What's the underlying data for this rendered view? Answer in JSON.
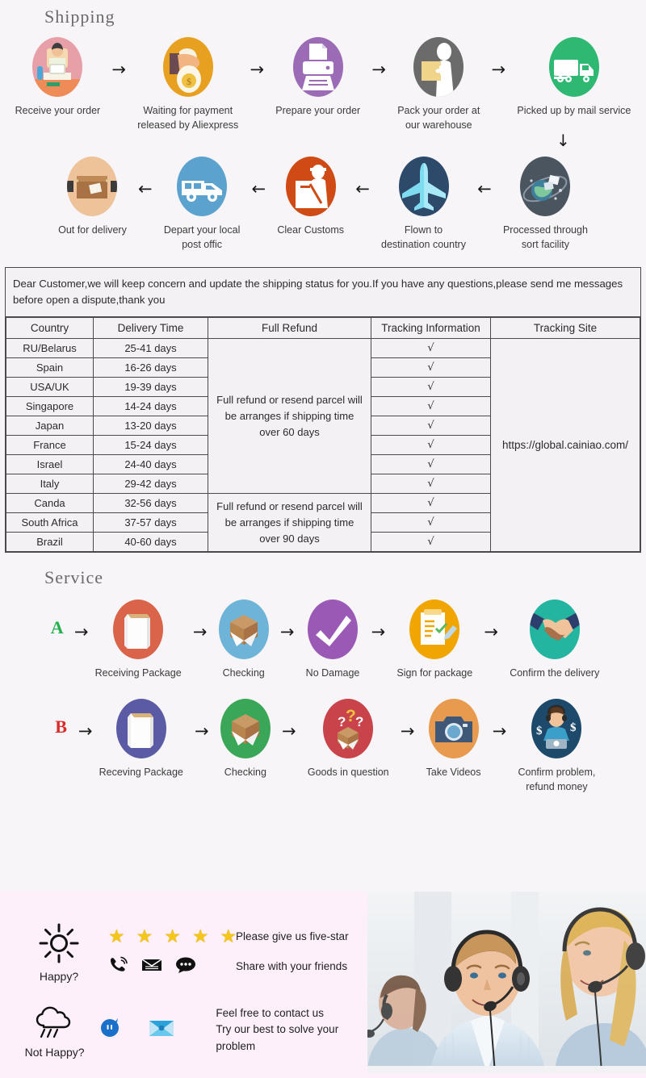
{
  "sections": {
    "shipping_title": "Shipping",
    "service_title": "Service"
  },
  "shipping_flow_row1": [
    {
      "label": "Receive your order",
      "icon": "person-at-desk-icon",
      "color": "#e8a0a8"
    },
    {
      "label": "Waiting for payment\nreleased by Aliexpress",
      "icon": "hand-with-coin-icon",
      "color": "#e8a020"
    },
    {
      "label": "Prepare your order",
      "icon": "printer-icon",
      "color": "#9b6bb5"
    },
    {
      "label": "Pack your order at\nour warehouse",
      "icon": "worker-with-box-icon",
      "color": "#6b6b6b"
    },
    {
      "label": "Picked up by mail service",
      "icon": "delivery-truck-icon",
      "color": "#2eb872"
    }
  ],
  "shipping_flow_row2": [
    {
      "label": "Out for delivery",
      "icon": "parcel-box-icon",
      "color": "#eec39a"
    },
    {
      "label": "Depart your local\npost offic",
      "icon": "delivery-van-icon",
      "color": "#5ba3ce"
    },
    {
      "label": "Clear  Customs",
      "icon": "customs-officer-icon",
      "color": "#cf4a15"
    },
    {
      "label": "Flown to\ndestination country",
      "icon": "airplane-icon",
      "color": "#2d4a6b"
    },
    {
      "label": "Processed through\nsort facility",
      "icon": "globe-sorting-icon",
      "color": "#4a5560"
    }
  ],
  "arrow_right": "→",
  "arrow_left": "←",
  "arrow_down": "↓",
  "notice": "Dear Customer,we will keep concern and update the shipping status for you.If you have any questions,please send me messages before open a dispute,thank you",
  "table": {
    "headers": [
      "Country",
      "Delivery Time",
      "Full Refund",
      "Tracking Information",
      "Tracking Site"
    ],
    "rows": [
      {
        "country": "RU/Belarus",
        "delivery": "25-41 days",
        "tracking": "√"
      },
      {
        "country": "Spain",
        "delivery": "16-26 days",
        "tracking": "√"
      },
      {
        "country": "USA/UK",
        "delivery": "19-39 days",
        "tracking": "√"
      },
      {
        "country": "Singapore",
        "delivery": "14-24 days",
        "tracking": "√"
      },
      {
        "country": "Japan",
        "delivery": "13-20 days",
        "tracking": "√"
      },
      {
        "country": "France",
        "delivery": "15-24 days",
        "tracking": "√"
      },
      {
        "country": "Israel",
        "delivery": "24-40 days",
        "tracking": "√"
      },
      {
        "country": "Italy",
        "delivery": "29-42 days",
        "tracking": "√"
      },
      {
        "country": "Canda",
        "delivery": "32-56 days",
        "tracking": "√"
      },
      {
        "country": "South Africa",
        "delivery": "37-57 days",
        "tracking": "√"
      },
      {
        "country": "Brazil",
        "delivery": "40-60 days",
        "tracking": "√"
      }
    ],
    "refund_60": "Full refund or resend parcel will be arranges if shipping time over 60 days",
    "refund_90": "Full refund or resend parcel will be arranges if shipping time over 90 days",
    "tracking_site": "https://global.cainiao.com/"
  },
  "service_a": {
    "letter": "A",
    "letter_color": "#22b14c",
    "steps": [
      {
        "label": "Receiving Package",
        "icon": "closed-package-icon",
        "color": "#d9644a"
      },
      {
        "label": "Checking",
        "icon": "open-box-icon",
        "color": "#6eb4d8"
      },
      {
        "label": "No Damage",
        "icon": "checkmark-icon",
        "color": "#9b59b6"
      },
      {
        "label": "Sign for package",
        "icon": "signed-document-icon",
        "color": "#f0a500"
      },
      {
        "label": "Confirm the delivery",
        "icon": "handshake-icon",
        "color": "#23b5a0"
      }
    ]
  },
  "service_b": {
    "letter": "B",
    "letter_color": "#d92b2b",
    "steps": [
      {
        "label": "Receving Package",
        "icon": "closed-package-icon",
        "color": "#5b5ba5"
      },
      {
        "label": "Checking",
        "icon": "open-box-icon",
        "color": "#3aa758"
      },
      {
        "label": "Goods in question",
        "icon": "question-box-icon",
        "color": "#c9434a"
      },
      {
        "label": "Take Videos",
        "icon": "camera-icon",
        "color": "#e89a4f"
      },
      {
        "label": "Confirm problem,\nrefund money",
        "icon": "support-agent-money-icon",
        "color": "#1d4a6b"
      }
    ]
  },
  "feedback": {
    "happy_label": "Happy?",
    "not_happy_label": "Not Happy?",
    "stars": [
      "★",
      "★",
      "★",
      "★",
      "★"
    ],
    "five_star_text": "Please give us five-star",
    "share_text": "Share with your friends",
    "contact_text": "Feel free to contact us\nTry our best to solve your problem",
    "icons": {
      "sun": "sun-icon",
      "rain_cloud": "rain-cloud-icon",
      "phone": "phone-ringing-icon",
      "envelope": "envelope-icon",
      "chat": "chat-bubble-icon",
      "message": "message-bubble-icon",
      "mail_blue": "blue-envelope-icon"
    },
    "photo_alt": "customer-service-team-photo"
  }
}
